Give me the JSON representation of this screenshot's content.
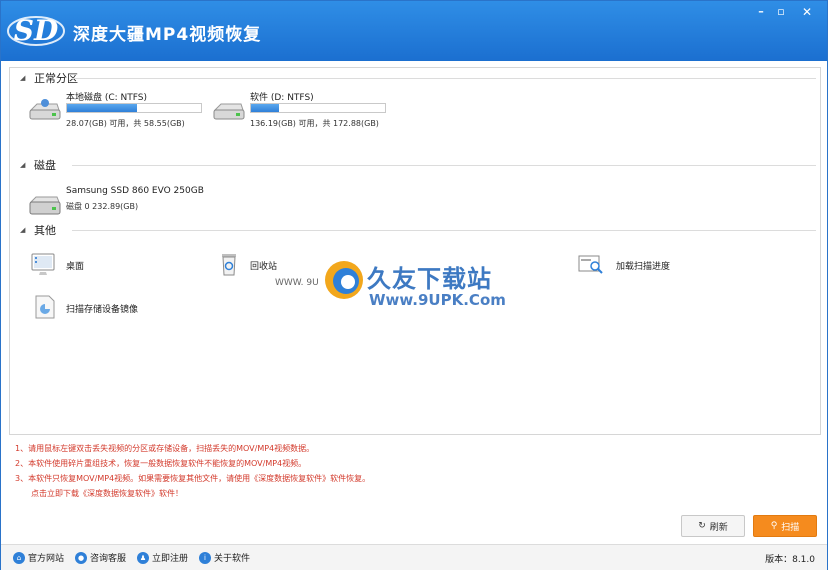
{
  "app": {
    "title": "深度大疆MP4视频恢复",
    "logo_text": "SD"
  },
  "window_controls": {
    "minimize": "–",
    "maximize": "▫",
    "close": "✕"
  },
  "sections": {
    "partitions": {
      "title": "正常分区"
    },
    "disks": {
      "title": "磁盘"
    },
    "others": {
      "title": "其他"
    }
  },
  "partitions": [
    {
      "name": "本地磁盘 (C: NTFS)",
      "info": "28.07(GB) 可用，共 58.55(GB)",
      "used_fraction": 0.52
    },
    {
      "name": "软件 (D: NTFS)",
      "info": "136.19(GB) 可用，共 172.88(GB)",
      "used_fraction": 0.21
    }
  ],
  "disk": {
    "name": "Samsung SSD 860 EVO 250GB",
    "info": "磁盘 0    232.89(GB)"
  },
  "others": {
    "desktop": "桌面",
    "recycle": "回收站",
    "load_progress": "加载扫描进度",
    "scan_image": "扫描存储设备镜像"
  },
  "watermark": {
    "brand": "久友下载站",
    "url": "Www.9UPK.Com",
    "left_text": "WWW. 9U"
  },
  "notes": [
    "1、请用鼠标左键双击丢失视频的分区或存储设备，扫描丢失的MOV/MP4视频数据。",
    "2、本软件使用碎片重组技术，恢复一般数据恢复软件不能恢复的MOV/MP4视频。",
    "3、本软件只恢复MOV/MP4视频。如果需要恢复其他文件，请使用《深度数据恢复软件》软件恢复。",
    "点击立即下载《深度数据恢复软件》软件！"
  ],
  "buttons": {
    "refresh": "刷新",
    "scan": "扫描"
  },
  "footer": {
    "links": [
      "官方网站",
      "咨询客服",
      "立即注册",
      "关于软件"
    ],
    "version": "版本：8.1.0"
  },
  "colors": {
    "title_bar": "#1b6fd0",
    "accent": "#f58b1e",
    "note": "#d33a2c"
  }
}
